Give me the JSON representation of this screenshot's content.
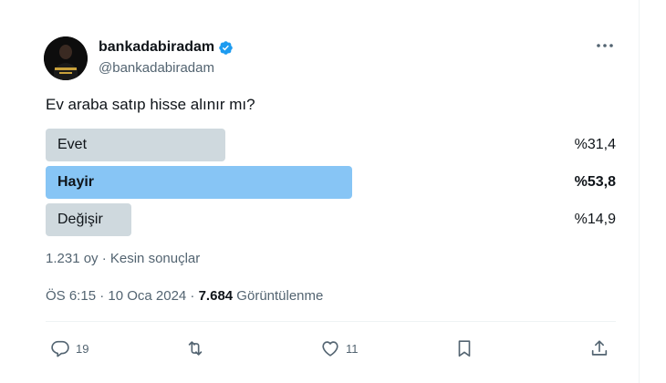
{
  "author": {
    "display_name": "bankadabiradam",
    "handle": "@bankadabiradam",
    "verified": true,
    "avatar_icon": "avatar-icon"
  },
  "tweet": {
    "question": "Ev araba satıp hisse alınır mı?"
  },
  "poll": {
    "options": [
      {
        "label": "Evet",
        "percent_text": "%31,4",
        "percent": 31.4,
        "winner": false
      },
      {
        "label": "Hayir",
        "percent_text": "%53,8",
        "percent": 53.8,
        "winner": true
      },
      {
        "label": "Değişir",
        "percent_text": "%14,9",
        "percent": 14.9,
        "winner": false
      }
    ],
    "meta": "1.231 oy · Kesin sonuçlar"
  },
  "timestamp": {
    "time_date": "ÖS 6:15 · 10 Oca 2024 · ",
    "views_count": "7.684",
    "views_label": " Görüntülenme"
  },
  "actions": {
    "replies": "19",
    "retweets": "",
    "likes": "11"
  },
  "colors": {
    "bar_default": "#cfd9de",
    "bar_winner": "#87c5f5",
    "verified_blue": "#1d9bf0",
    "muted_text": "#536471"
  }
}
